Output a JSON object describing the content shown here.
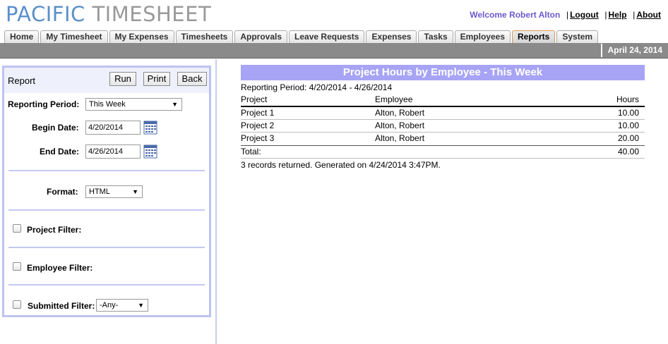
{
  "app": {
    "logo_part1": "PACIFIC",
    "logo_part2": "TIMESHEET"
  },
  "userbar": {
    "welcome": "Welcome Robert Alton",
    "logout": "Logout",
    "help": "Help",
    "about": "About"
  },
  "tabs": [
    {
      "label": "Home"
    },
    {
      "label": "My Timesheet"
    },
    {
      "label": "My Expenses"
    },
    {
      "label": "Timesheets"
    },
    {
      "label": "Approvals"
    },
    {
      "label": "Leave Requests"
    },
    {
      "label": "Expenses"
    },
    {
      "label": "Tasks"
    },
    {
      "label": "Employees"
    },
    {
      "label": "Reports",
      "active": true
    },
    {
      "label": "System"
    }
  ],
  "current_date": "April 24, 2014",
  "panel": {
    "title": "Report",
    "run_label": "Run",
    "print_label": "Print",
    "back_label": "Back",
    "reporting_period_label": "Reporting Period:",
    "reporting_period_value": "This Week",
    "begin_date_label": "Begin Date:",
    "begin_date_value": "4/20/2014",
    "end_date_label": "End Date:",
    "end_date_value": "4/26/2014",
    "format_label": "Format:",
    "format_value": "HTML",
    "project_filter_label": "Project Filter:",
    "employee_filter_label": "Employee Filter:",
    "submitted_filter_label": "Submitted Filter:",
    "submitted_filter_value": "-Any-"
  },
  "report": {
    "title": "Project Hours by Employee - This Week",
    "period": "Reporting Period: 4/20/2014 - 4/26/2014",
    "columns": {
      "project": "Project",
      "employee": "Employee",
      "hours": "Hours"
    },
    "rows": [
      {
        "project": "Project 1",
        "employee": "Alton, Robert",
        "hours": "10.00"
      },
      {
        "project": "Project 2",
        "employee": "Alton, Robert",
        "hours": "10.00"
      },
      {
        "project": "Project 3",
        "employee": "Alton, Robert",
        "hours": "20.00"
      }
    ],
    "total_label": "Total:",
    "total_value": "40.00",
    "footer": "3 records returned. Generated on 4/24/2014 3:47PM."
  },
  "colors": {
    "report_title_bg": "#a7a4f5",
    "panel_border": "#bdc3f1",
    "welcome_text": "#6a5acd",
    "logo_blue": "#5b8fc9"
  }
}
